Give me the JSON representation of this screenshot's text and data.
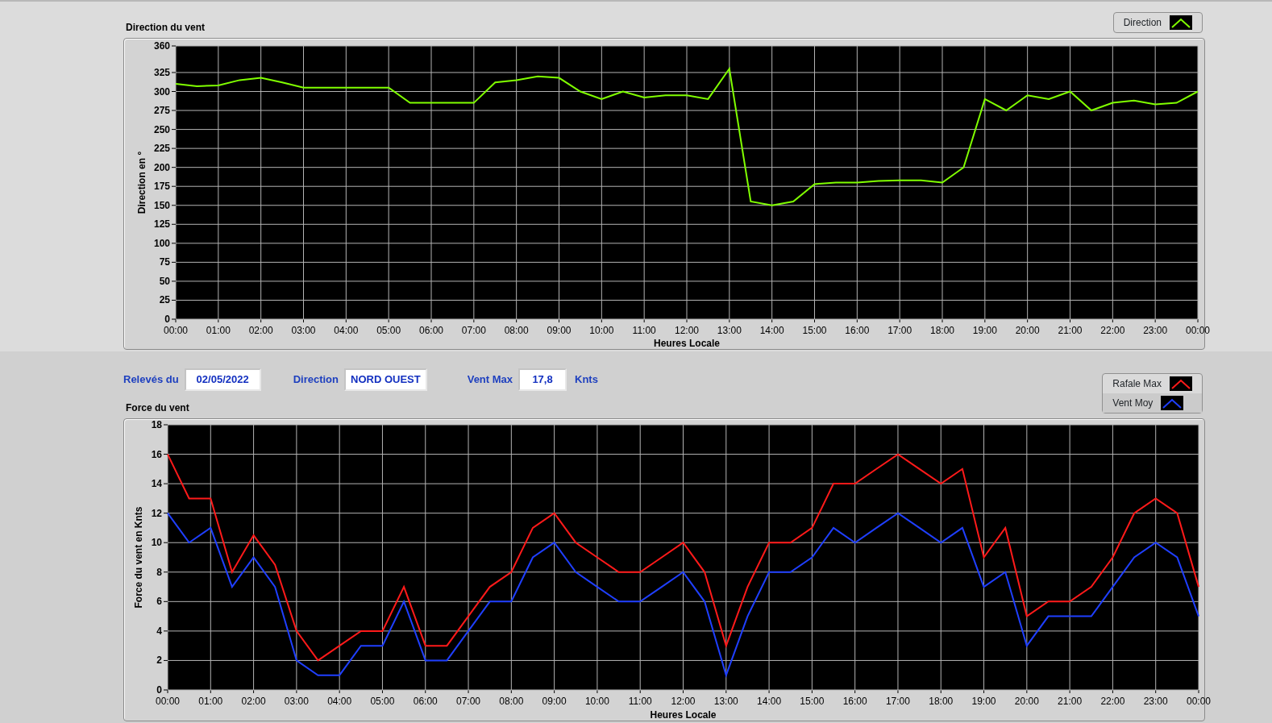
{
  "direction_chart": {
    "title": "Direction du vent",
    "chart_data": {
      "type": "line",
      "xlabel": "Heures Locale",
      "ylabel": "Direction en °",
      "grid": true,
      "xlim": [
        0,
        24
      ],
      "ylim": [
        0,
        360
      ],
      "x": [
        0,
        0.5,
        1,
        1.5,
        2,
        2.5,
        3,
        3.5,
        4,
        4.5,
        5,
        5.5,
        6,
        6.5,
        7,
        7.5,
        8,
        8.5,
        9,
        9.5,
        10,
        10.5,
        11,
        11.5,
        12,
        12.5,
        13,
        13.5,
        14,
        14.5,
        15,
        15.5,
        16,
        16.5,
        17,
        17.5,
        18,
        18.5,
        19,
        19.5,
        20,
        20.5,
        21,
        21.5,
        22,
        22.5,
        23,
        23.5,
        24
      ],
      "xticks": [
        {
          "value": 0,
          "label": "00:00"
        },
        {
          "value": 1,
          "label": "01:00"
        },
        {
          "value": 2,
          "label": "02:00"
        },
        {
          "value": 3,
          "label": "03:00"
        },
        {
          "value": 4,
          "label": "04:00"
        },
        {
          "value": 5,
          "label": "05:00"
        },
        {
          "value": 6,
          "label": "06:00"
        },
        {
          "value": 7,
          "label": "07:00"
        },
        {
          "value": 8,
          "label": "08:00"
        },
        {
          "value": 9,
          "label": "09:00"
        },
        {
          "value": 10,
          "label": "10:00"
        },
        {
          "value": 11,
          "label": "11:00"
        },
        {
          "value": 12,
          "label": "12:00"
        },
        {
          "value": 13,
          "label": "13:00"
        },
        {
          "value": 14,
          "label": "14:00"
        },
        {
          "value": 15,
          "label": "15:00"
        },
        {
          "value": 16,
          "label": "16:00"
        },
        {
          "value": 17,
          "label": "17:00"
        },
        {
          "value": 18,
          "label": "18:00"
        },
        {
          "value": 19,
          "label": "19:00"
        },
        {
          "value": 20,
          "label": "20:00"
        },
        {
          "value": 21,
          "label": "21:00"
        },
        {
          "value": 22,
          "label": "22:00"
        },
        {
          "value": 23,
          "label": "23:00"
        },
        {
          "value": 24,
          "label": "00:00"
        }
      ],
      "yticks": [
        0,
        25,
        50,
        75,
        100,
        125,
        150,
        175,
        200,
        225,
        250,
        275,
        300,
        325,
        360
      ],
      "series": [
        {
          "name": "Direction",
          "color": "#80ff00",
          "values": [
            310,
            307,
            308,
            315,
            318,
            312,
            305,
            305,
            305,
            305,
            305,
            285,
            285,
            285,
            285,
            312,
            315,
            320,
            318,
            300,
            290,
            300,
            292,
            295,
            295,
            290,
            330,
            155,
            150,
            155,
            178,
            180,
            180,
            182,
            183,
            183,
            180,
            200,
            290,
            275,
            295,
            290,
            300,
            275,
            285,
            288,
            283,
            285,
            300
          ]
        }
      ]
    }
  },
  "readings": [
    {
      "label": "Relevés du",
      "value": "02/05/2022"
    },
    {
      "label": "Direction",
      "value": "NORD OUEST"
    },
    {
      "label": "Vent Max",
      "value": "17,8",
      "unit": "Knts"
    }
  ],
  "force_chart": {
    "title": "Force du vent",
    "chart_data": {
      "type": "line",
      "xlabel": "Heures Locale",
      "ylabel": "Force du vent en Knts",
      "grid": true,
      "xlim": [
        0,
        24
      ],
      "ylim": [
        0,
        18
      ],
      "x": [
        0,
        0.5,
        1,
        1.5,
        2,
        2.5,
        3,
        3.5,
        4,
        4.5,
        5,
        5.5,
        6,
        6.5,
        7,
        7.5,
        8,
        8.5,
        9,
        9.5,
        10,
        10.5,
        11,
        11.5,
        12,
        12.5,
        13,
        13.5,
        14,
        14.5,
        15,
        15.5,
        16,
        16.5,
        17,
        17.5,
        18,
        18.5,
        19,
        19.5,
        20,
        20.5,
        21,
        21.5,
        22,
        22.5,
        23,
        23.5,
        24
      ],
      "xticks": [
        {
          "value": 0,
          "label": "00:00"
        },
        {
          "value": 1,
          "label": "01:00"
        },
        {
          "value": 2,
          "label": "02:00"
        },
        {
          "value": 3,
          "label": "03:00"
        },
        {
          "value": 4,
          "label": "04:00"
        },
        {
          "value": 5,
          "label": "05:00"
        },
        {
          "value": 6,
          "label": "06:00"
        },
        {
          "value": 7,
          "label": "07:00"
        },
        {
          "value": 8,
          "label": "08:00"
        },
        {
          "value": 9,
          "label": "09:00"
        },
        {
          "value": 10,
          "label": "10:00"
        },
        {
          "value": 11,
          "label": "11:00"
        },
        {
          "value": 12,
          "label": "12:00"
        },
        {
          "value": 13,
          "label": "13:00"
        },
        {
          "value": 14,
          "label": "14:00"
        },
        {
          "value": 15,
          "label": "15:00"
        },
        {
          "value": 16,
          "label": "16:00"
        },
        {
          "value": 17,
          "label": "17:00"
        },
        {
          "value": 18,
          "label": "18:00"
        },
        {
          "value": 19,
          "label": "19:00"
        },
        {
          "value": 20,
          "label": "20:00"
        },
        {
          "value": 21,
          "label": "21:00"
        },
        {
          "value": 22,
          "label": "22:00"
        },
        {
          "value": 23,
          "label": "23:00"
        },
        {
          "value": 24,
          "label": "00:00"
        }
      ],
      "yticks": [
        0,
        2,
        4,
        6,
        8,
        10,
        12,
        14,
        16,
        18
      ],
      "series": [
        {
          "name": "Rafale Max",
          "color": "#ff1a1a",
          "values": [
            16,
            13,
            13,
            8,
            10.5,
            8.5,
            4,
            2,
            3,
            4,
            4,
            7,
            3,
            3,
            5,
            7,
            8,
            11,
            12,
            10,
            9,
            8,
            8,
            9,
            10,
            8,
            3,
            7,
            10,
            10,
            11,
            14,
            14,
            15,
            16,
            15,
            14,
            15,
            9,
            11,
            5,
            6,
            6,
            7,
            9,
            12,
            13,
            12,
            7
          ]
        },
        {
          "name": "Vent Moy",
          "color": "#1f3fff",
          "values": [
            12,
            10,
            11,
            7,
            9,
            7,
            2,
            1,
            1,
            3,
            3,
            6,
            2,
            2,
            4,
            6,
            6,
            9,
            10,
            8,
            7,
            6,
            6,
            7,
            8,
            6,
            1,
            5,
            8,
            8,
            9,
            11,
            10,
            11,
            12,
            11,
            10,
            11,
            7,
            8,
            3,
            5,
            5,
            5,
            7,
            9,
            10,
            9,
            5
          ]
        }
      ]
    }
  }
}
